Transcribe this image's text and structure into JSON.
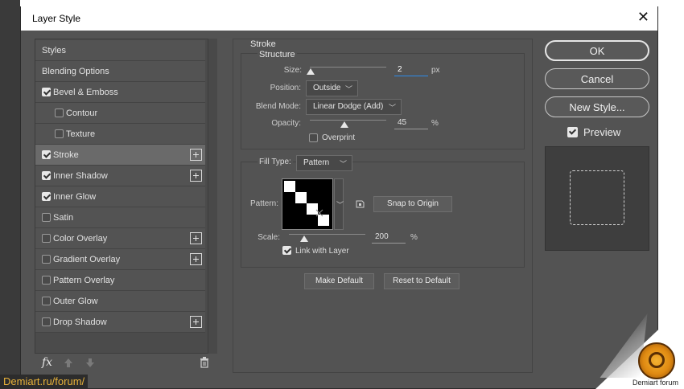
{
  "dialog": {
    "title": "Layer Style"
  },
  "styles_list": [
    {
      "label": "Styles",
      "checkbox": false,
      "checked": false,
      "plus": false,
      "indent": 0,
      "selected": false
    },
    {
      "label": "Blending Options",
      "checkbox": false,
      "checked": false,
      "plus": false,
      "indent": 0,
      "selected": false
    },
    {
      "label": "Bevel & Emboss",
      "checkbox": true,
      "checked": true,
      "plus": false,
      "indent": 0,
      "selected": false
    },
    {
      "label": "Contour",
      "checkbox": true,
      "checked": false,
      "plus": false,
      "indent": 1,
      "selected": false
    },
    {
      "label": "Texture",
      "checkbox": true,
      "checked": false,
      "plus": false,
      "indent": 1,
      "selected": false
    },
    {
      "label": "Stroke",
      "checkbox": true,
      "checked": true,
      "plus": true,
      "indent": 0,
      "selected": true
    },
    {
      "label": "Inner Shadow",
      "checkbox": true,
      "checked": true,
      "plus": true,
      "indent": 0,
      "selected": false
    },
    {
      "label": "Inner Glow",
      "checkbox": true,
      "checked": true,
      "plus": false,
      "indent": 0,
      "selected": false
    },
    {
      "label": "Satin",
      "checkbox": true,
      "checked": false,
      "plus": false,
      "indent": 0,
      "selected": false
    },
    {
      "label": "Color Overlay",
      "checkbox": true,
      "checked": false,
      "plus": true,
      "indent": 0,
      "selected": false
    },
    {
      "label": "Gradient Overlay",
      "checkbox": true,
      "checked": false,
      "plus": true,
      "indent": 0,
      "selected": false
    },
    {
      "label": "Pattern Overlay",
      "checkbox": true,
      "checked": false,
      "plus": false,
      "indent": 0,
      "selected": false
    },
    {
      "label": "Outer Glow",
      "checkbox": true,
      "checked": false,
      "plus": false,
      "indent": 0,
      "selected": false
    },
    {
      "label": "Drop Shadow",
      "checkbox": true,
      "checked": false,
      "plus": true,
      "indent": 0,
      "selected": false
    }
  ],
  "bottom_icons": {
    "fx": "fx",
    "up": "arrow-up-icon",
    "down": "arrow-down-icon",
    "trash": "trash-icon"
  },
  "stroke": {
    "section_title": "Stroke",
    "structure_title": "Structure",
    "size_label": "Size:",
    "size_value": "2",
    "size_unit": "px",
    "size_fraction": 0.01,
    "position_label": "Position:",
    "position_value": "Outside",
    "blend_label": "Blend Mode:",
    "blend_value": "Linear Dodge (Add)",
    "opacity_label": "Opacity:",
    "opacity_value": "45",
    "opacity_unit": "%",
    "opacity_fraction": 0.45,
    "overprint_label": "Overprint",
    "overprint_checked": false
  },
  "fill": {
    "fill_type_label": "Fill Type:",
    "fill_type_value": "Pattern",
    "pattern_label": "Pattern:",
    "snap_label": "Snap to Origin",
    "scale_label": "Scale:",
    "scale_value": "200",
    "scale_unit": "%",
    "scale_fraction": 0.2,
    "link_label": "Link with Layer",
    "link_checked": true
  },
  "make_default_label": "Make Default",
  "reset_default_label": "Reset to Default",
  "buttons": {
    "ok": "OK",
    "cancel": "Cancel",
    "new_style": "New Style..."
  },
  "preview": {
    "label": "Preview",
    "checked": true
  },
  "watermark": "Demiart.ru/forum/",
  "forum_badge": "Demiart forum",
  "colors": {
    "dialog_bg": "#535353",
    "selected_row": "#6a6a6a",
    "focus_blue": "#2d8ceb",
    "watermark_text": "#e8b23a"
  }
}
